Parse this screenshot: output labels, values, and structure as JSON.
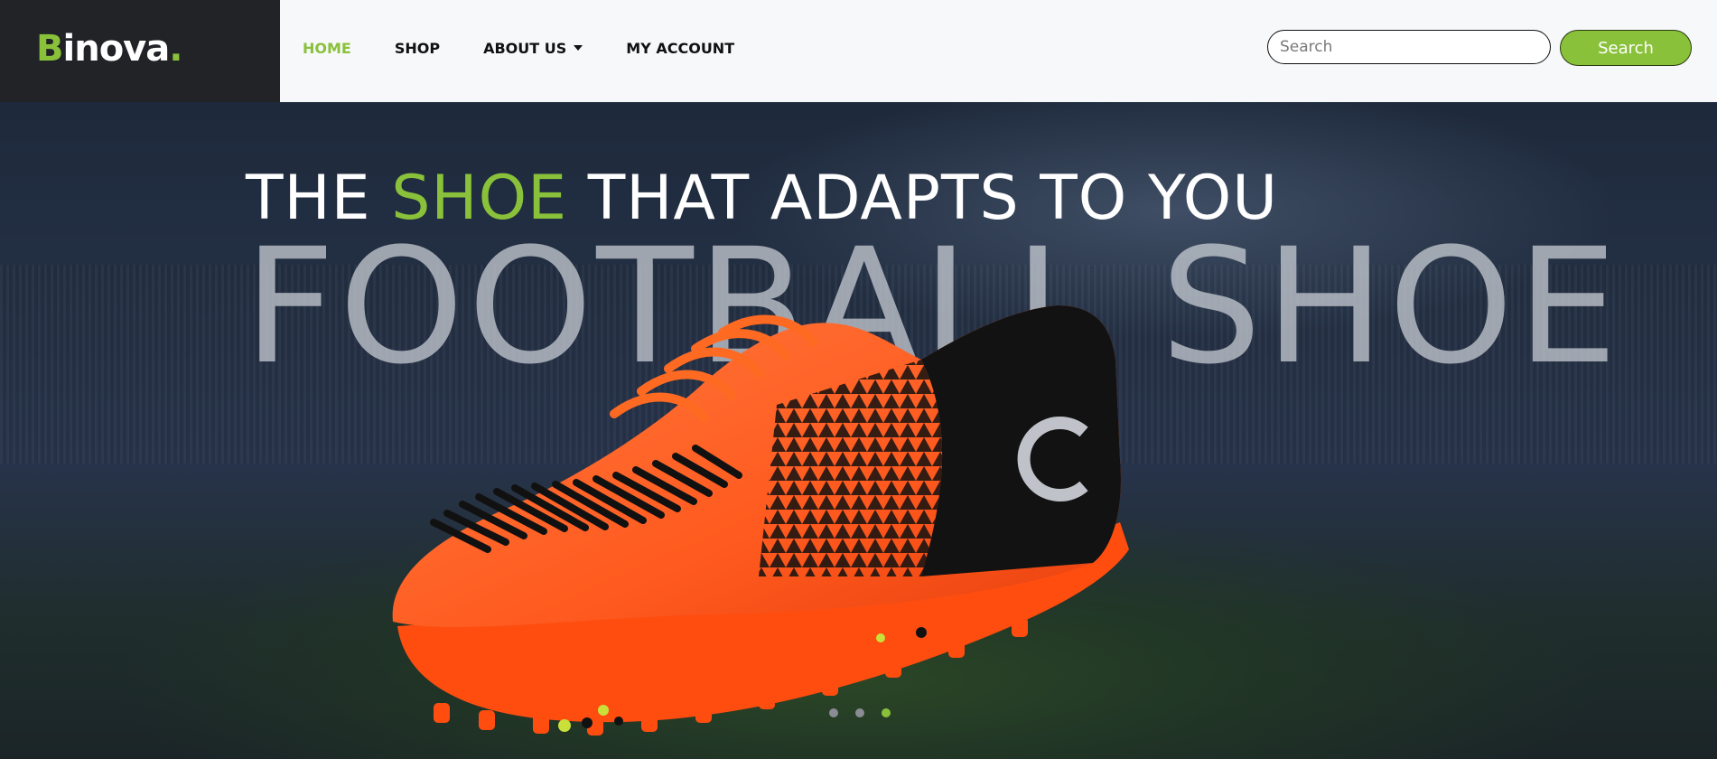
{
  "brand": {
    "first_letter": "B",
    "rest": "inova",
    "dot": "."
  },
  "nav": {
    "items": [
      {
        "label": "HOME",
        "active": true
      },
      {
        "label": "SHOP",
        "active": false
      },
      {
        "label": "ABOUT US",
        "active": false,
        "dropdown": true
      },
      {
        "label": "MY ACCOUNT",
        "active": false
      }
    ]
  },
  "search": {
    "placeholder": "Search",
    "button_label": "Search"
  },
  "hero": {
    "headline_pre": "THE",
    "headline_accent": "SHOE",
    "headline_post": "THAT ADAPTS TO YOU",
    "big_title": "FOOTBALL SHOE",
    "shoe_brand_letter": "C",
    "slide_count": 3,
    "active_slide": 3
  },
  "colors": {
    "accent": "#8ac13a",
    "dark": "#212327",
    "nav_bg": "#f7f8fa",
    "shoe_orange": "#ff5a1f"
  }
}
